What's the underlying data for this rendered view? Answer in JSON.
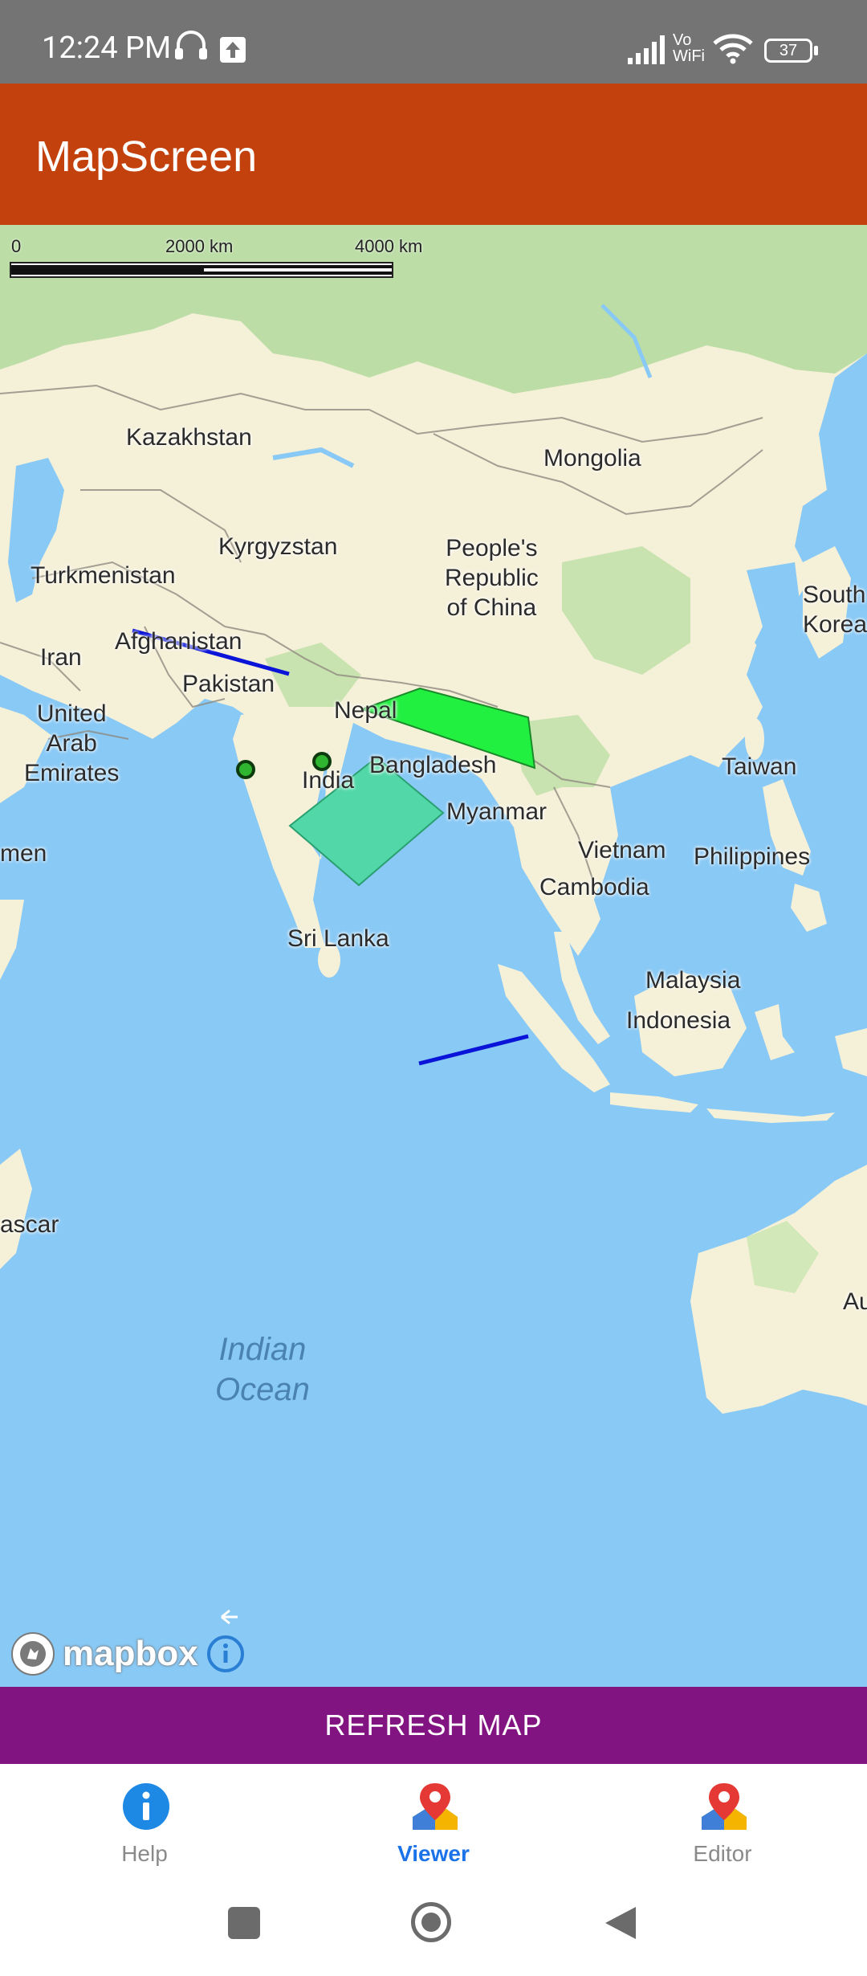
{
  "status": {
    "time": "12:24 PM",
    "network": "Vo\nWiFi",
    "battery": "37"
  },
  "app": {
    "title": "MapScreen"
  },
  "map": {
    "scale": {
      "labels": [
        "0",
        "2000 km",
        "4000 km"
      ]
    },
    "labels": {
      "kazakhstan": "Kazakhstan",
      "mongolia": "Mongolia",
      "kyrgyzstan": "Kyrgyzstan",
      "china": "People's\nRepublic\nof China",
      "turkmenistan": "Turkmenistan",
      "south_korea": "South\nKorea",
      "iran": "Iran",
      "afghanistan": "Afghanistan",
      "pakistan": "Pakistan",
      "nepal": "Nepal",
      "uae": "United\nArab\nEmirates",
      "bangladesh": "Bangladesh",
      "taiwan": "Taiwan",
      "india": "India",
      "myanmar": "Myanmar",
      "yemen": "men",
      "vietnam": "Vietnam",
      "philippines": "Philippines",
      "cambodia": "Cambodia",
      "sri_lanka": "Sri Lanka",
      "malaysia": "Malaysia",
      "indonesia": "Indonesia",
      "madagascar": "ascar",
      "australia": "Au",
      "ocean": "Indian\nOcean"
    },
    "attribution": {
      "logo_text": "mapbox"
    },
    "overlay_colors": {
      "line": "#0a14d8",
      "polygon_bright": "#22f040",
      "polygon_teal": "#52d8a8",
      "marker_fill": "#2fb52f"
    }
  },
  "actions": {
    "refresh_label": "REFRESH MAP"
  },
  "bottom_nav": {
    "items": [
      {
        "label": "Help",
        "icon": "info-icon",
        "active": false
      },
      {
        "label": "Viewer",
        "icon": "map-pin-icon",
        "active": true
      },
      {
        "label": "Editor",
        "icon": "map-pin-icon",
        "active": false
      }
    ]
  },
  "colors": {
    "app_bar": "#c3410d",
    "refresh_button": "#821482",
    "active_nav": "#1a73e8",
    "water": "#89c9f5"
  }
}
